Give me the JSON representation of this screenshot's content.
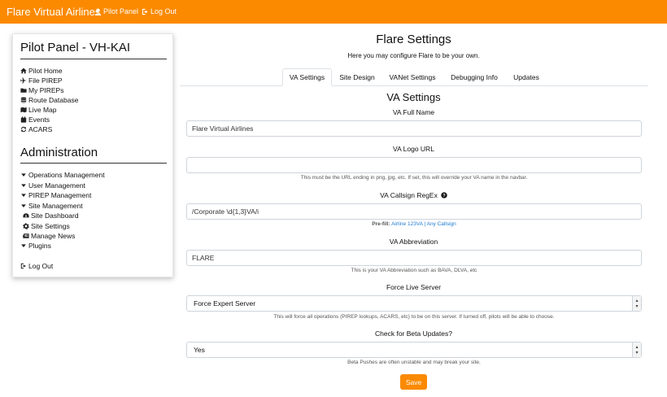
{
  "navbar": {
    "brand": "Flare Virtual Airlines",
    "pilot_panel": "Pilot Panel",
    "log_out": "Log Out",
    "bg_color": "#fb8a00"
  },
  "sidebar": {
    "title": "Pilot Panel - VH-KAI",
    "items": [
      {
        "label": "Pilot Home",
        "icon": "home-icon"
      },
      {
        "label": "File PIREP",
        "icon": "plane-icon"
      },
      {
        "label": "My PIREPs",
        "icon": "folder-icon"
      },
      {
        "label": "Route Database",
        "icon": "database-icon"
      },
      {
        "label": "Live Map",
        "icon": "map-icon"
      },
      {
        "label": "Events",
        "icon": "calendar-icon"
      },
      {
        "label": "ACARS",
        "icon": "sync-icon"
      }
    ],
    "admin_title": "Administration",
    "admin_items": [
      {
        "label": "Operations Management"
      },
      {
        "label": "User Management"
      },
      {
        "label": "PIREP Management"
      },
      {
        "label": "Site Management"
      },
      {
        "label": "Site Dashboard",
        "icon": "dashboard-icon"
      },
      {
        "label": "Site Settings",
        "icon": "gear-icon"
      },
      {
        "label": "Manage News",
        "icon": "newspaper-icon"
      },
      {
        "label": "Plugins"
      }
    ],
    "log_out": "Log Out"
  },
  "main": {
    "title": "Flare Settings",
    "subtitle": "Here you may configure Flare to be your own.",
    "tabs": [
      {
        "label": "VA Settings",
        "active": true
      },
      {
        "label": "Site Design",
        "active": false
      },
      {
        "label": "VANet Settings",
        "active": false
      },
      {
        "label": "Debugging Info",
        "active": false
      },
      {
        "label": "Updates",
        "active": false
      }
    ],
    "section_title": "VA Settings"
  },
  "form": {
    "va_name_label": "VA Full Name",
    "va_name_value": "Flare Virtual Airlines",
    "logo_label": "VA Logo URL",
    "logo_value": "",
    "logo_help": "This must be the URL ending in png, jpg, etc. If set, this will override your VA name in the navbar.",
    "regex_label": "VA Callsign RegEx",
    "regex_value": "/Corporate \\d{1,3}VA/i",
    "prefill_label": "Pre-fill:",
    "prefill_option1": "Airline 123VA",
    "prefill_sep": "|",
    "prefill_option2": "Any Callsign",
    "abbr_label": "VA Abbreviation",
    "abbr_value": "FLARE",
    "abbr_help": "This is your VA Abbreviation such as BAVA, DLVA, etc",
    "live_label": "Force Live Server",
    "live_value": "Force Expert Server",
    "live_help": "This will force all operations (PIREP lookups, ACARS, etc) to be on this server. If turned off, pilots will be able to choose.",
    "beta_label": "Check for Beta Updates?",
    "beta_value": "Yes",
    "beta_help": "Beta Pushes are often unstable and may break your site.",
    "save_label": "Save"
  }
}
